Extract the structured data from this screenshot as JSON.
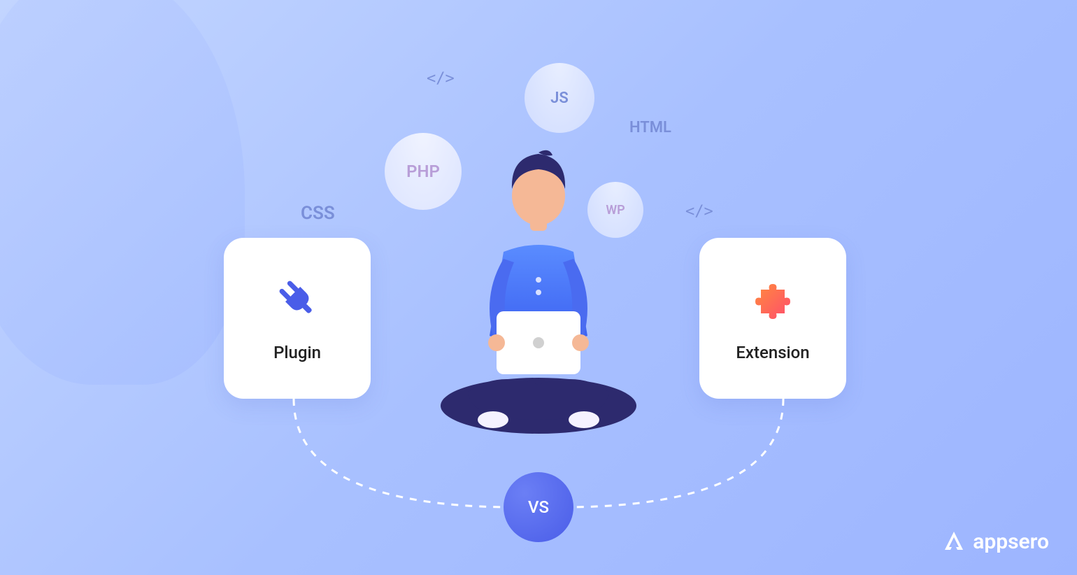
{
  "tech": {
    "js": "JS",
    "php": "PHP",
    "wp": "WP",
    "css": "CSS",
    "html": "HTML",
    "code_tag": "</>"
  },
  "cards": {
    "plugin_label": "Plugin",
    "extension_label": "Extension"
  },
  "vs_label": "VS",
  "brand": {
    "name": "appsero"
  },
  "colors": {
    "plugin_icon": "#4a5de8",
    "extension_icon_start": "#ff8a3d",
    "extension_icon_end": "#ff4d6d",
    "vs_gradient_start": "#6b7ff5",
    "vs_gradient_end": "#4a5de8"
  }
}
